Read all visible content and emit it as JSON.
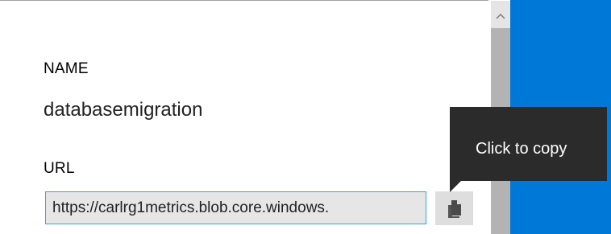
{
  "fields": {
    "name_label": "NAME",
    "name_value": "databasemigration",
    "url_label": "URL",
    "url_value": "https://carlrg1metrics.blob.core.windows."
  },
  "copy_button": {
    "icon": "copy-icon"
  },
  "tooltip": {
    "text": "Click to copy"
  },
  "scrollbar": {
    "up_icon": "chevron-up-icon"
  },
  "colors": {
    "accent_blue": "#0078d7",
    "input_border": "#3aa0df",
    "tooltip_bg": "#2b2b2b"
  }
}
